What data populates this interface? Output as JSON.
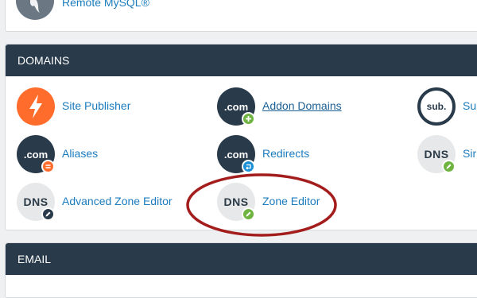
{
  "top_section": {
    "remote_mysql_label": "Remote MySQL®"
  },
  "domains": {
    "header": "DOMAINS",
    "items": [
      {
        "label": "Site Publisher",
        "icon": "lightning-icon"
      },
      {
        "label": "Addon Domains",
        "icon_text": ".com",
        "badge": "plus-badge"
      },
      {
        "label": "Su",
        "icon_text": "sub."
      },
      {
        "label": "Aliases",
        "icon_text": ".com",
        "badge": "equals-badge"
      },
      {
        "label": "Redirects",
        "icon_text": ".com",
        "badge": "redirect-badge"
      },
      {
        "label": "Sir",
        "icon_text": "DNS",
        "badge": "edit-badge"
      },
      {
        "label": "Advanced Zone Editor",
        "icon_text": "DNS",
        "badge": "edit-badge"
      },
      {
        "label": "Zone Editor",
        "icon_text": "DNS",
        "badge": "edit-badge"
      }
    ]
  },
  "email": {
    "header": "EMAIL"
  },
  "colors": {
    "header_bg": "#293a4a",
    "link": "#1b7bbd",
    "badge_green": "#6fb440",
    "badge_orange": "#ff6c2c",
    "badge_blue": "#1b90d6",
    "highlight": "#a31d1d"
  }
}
